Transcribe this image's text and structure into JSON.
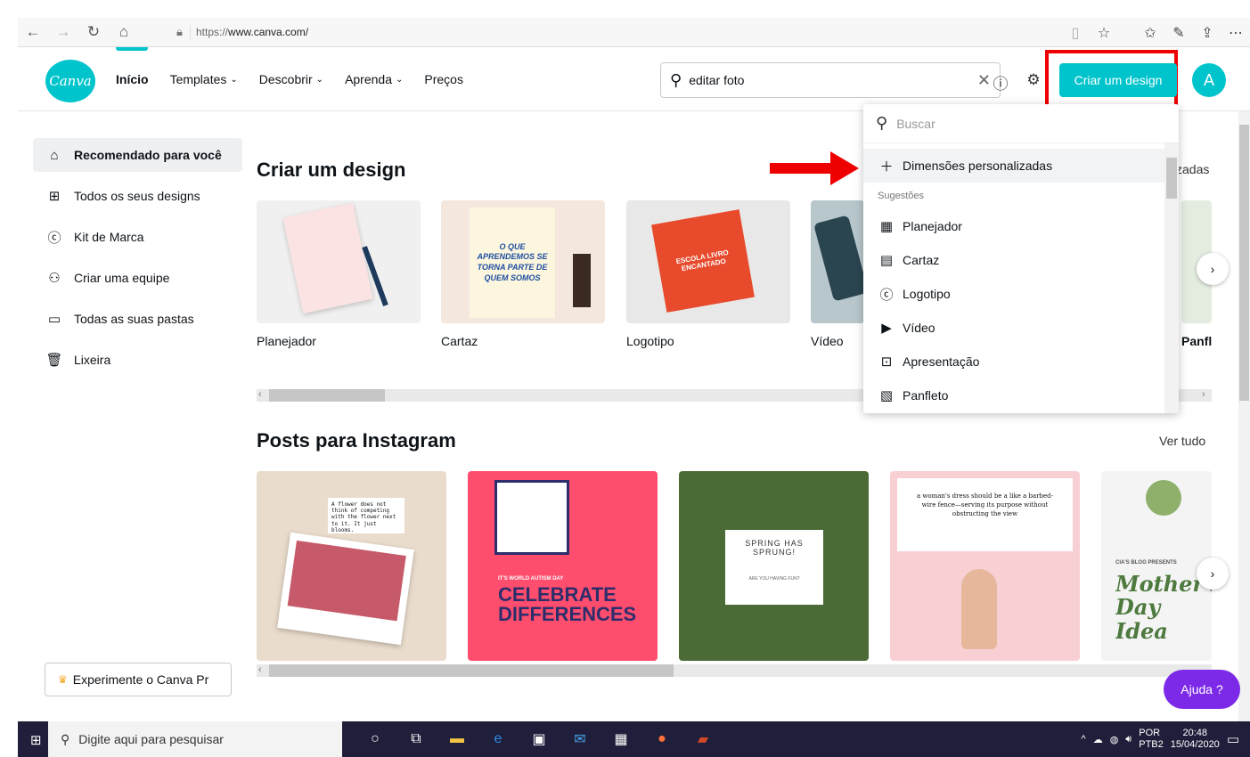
{
  "browser": {
    "url_prefix": "https://",
    "url_domain": "www.canva.com/"
  },
  "header": {
    "logo_text": "Canva",
    "menu": [
      {
        "label": "Início",
        "chevron": false
      },
      {
        "label": "Templates",
        "chevron": true
      },
      {
        "label": "Descobrir",
        "chevron": true
      },
      {
        "label": "Aprenda",
        "chevron": true
      },
      {
        "label": "Preços",
        "chevron": false
      }
    ],
    "search_value": "editar foto",
    "create_label": "Criar um design",
    "avatar_letter": "A"
  },
  "sidebar": {
    "items": [
      {
        "label": "Recomendado para você",
        "icon": "home-icon"
      },
      {
        "label": "Todos os seus designs",
        "icon": "grid-icon"
      },
      {
        "label": "Kit de Marca",
        "icon": "brand-kit-icon"
      },
      {
        "label": "Criar uma equipe",
        "icon": "add-team-icon"
      },
      {
        "label": "Todas as suas pastas",
        "icon": "folder-icon"
      },
      {
        "label": "Lixeira",
        "icon": "trash-icon"
      }
    ],
    "pro_label": "Experimente o Canva Pr"
  },
  "section1": {
    "title": "Criar um design",
    "partial_right": "zadas",
    "cards": [
      {
        "label": "Planejador",
        "color": "#f2f2f2"
      },
      {
        "label": "Cartaz",
        "color": "#f4e8de"
      },
      {
        "label": "Logotipo",
        "color": "#e8e8e8"
      },
      {
        "label": "Vídeo",
        "color": "#c8d3d8"
      },
      {
        "label": "Panfl",
        "color": "#e4ece0"
      }
    ],
    "poster_text": "O QUE APRENDEMOS SE TORNA PARTE DE QUEM SOMOS",
    "logo_text": "ESCOLA LIVRO ENCANTADO"
  },
  "section2": {
    "title": "Posts para Instagram",
    "see_all": "Ver tudo",
    "cards": [
      {
        "color": "#eadccc",
        "text": "A flower does not think of competing with the flower next to it. It just blooms."
      },
      {
        "color": "#ff4d6d",
        "text": "CELEBRATE DIFFERENCES",
        "sub": "IT'S WORLD AUTISM DAY"
      },
      {
        "color": "#4a6b35",
        "text": "SPRING HAS SPRUNG!",
        "sub": "ARE YOU HAVING FUN?"
      },
      {
        "color": "#f8d0d4",
        "text": "a woman's dress should be a like a barbed-wire fence—serving its purpose without obstructing the view"
      },
      {
        "color": "#f4f4f4",
        "text": "Mother's Day Idea",
        "sub": "CIA'S BLOG PRESENTS"
      }
    ]
  },
  "dropdown": {
    "search_placeholder": "Buscar",
    "custom": "Dimensões personalizadas",
    "suggestions_label": "Sugestões",
    "items": [
      {
        "label": "Planejador",
        "icon": "planner-icon"
      },
      {
        "label": "Cartaz",
        "icon": "poster-icon"
      },
      {
        "label": "Logotipo",
        "icon": "logo-icon"
      },
      {
        "label": "Vídeo",
        "icon": "video-icon"
      },
      {
        "label": "Apresentação",
        "icon": "presentation-icon"
      },
      {
        "label": "Panfleto",
        "icon": "flyer-icon"
      }
    ]
  },
  "help_label": "Ajuda ?",
  "taskbar": {
    "search_placeholder": "Digite aqui para pesquisar",
    "lang1": "POR",
    "lang2": "PTB2",
    "time": "20:48",
    "date": "15/04/2020"
  },
  "colors": {
    "accent": "#00c4cc",
    "help": "#7d2ae8",
    "highlight": "#e00000"
  }
}
